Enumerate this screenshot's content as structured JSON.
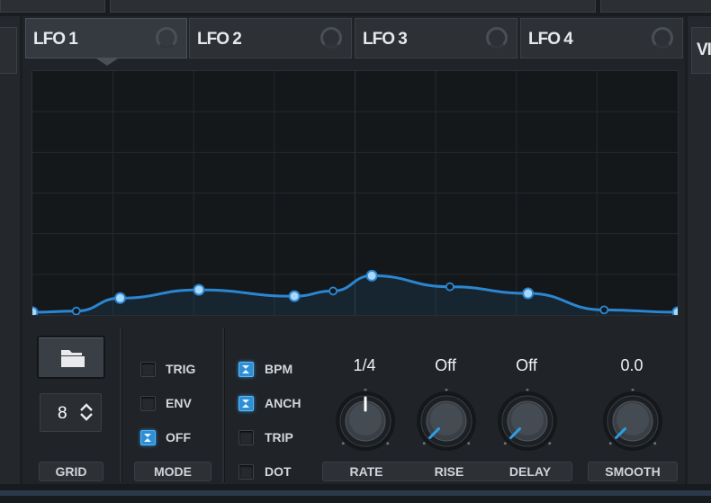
{
  "tabs": [
    {
      "label": "LFO 1",
      "active": true
    },
    {
      "label": "LFO 2",
      "active": false
    },
    {
      "label": "LFO 3",
      "active": false
    },
    {
      "label": "LFO 4",
      "active": false
    }
  ],
  "next_tab_partial": "VI",
  "graph": {
    "curve_color": "#2b86d1",
    "grid_divisions": 8,
    "points": [
      {
        "x": 0.0,
        "y": 0.0,
        "type": "anchor"
      },
      {
        "x": 0.068,
        "y": 0.005,
        "type": "curve"
      },
      {
        "x": 0.136,
        "y": 0.06,
        "type": "anchor"
      },
      {
        "x": 0.258,
        "y": 0.095,
        "type": "anchor"
      },
      {
        "x": 0.406,
        "y": 0.068,
        "type": "anchor"
      },
      {
        "x": 0.466,
        "y": 0.09,
        "type": "curve"
      },
      {
        "x": 0.526,
        "y": 0.155,
        "type": "anchor"
      },
      {
        "x": 0.647,
        "y": 0.108,
        "type": "curve"
      },
      {
        "x": 0.768,
        "y": 0.08,
        "type": "anchor"
      },
      {
        "x": 0.886,
        "y": 0.01,
        "type": "curve"
      },
      {
        "x": 1.0,
        "y": 0.0,
        "type": "anchor"
      }
    ]
  },
  "grid": {
    "value": "8",
    "label": "GRID"
  },
  "mode": {
    "label": "MODE",
    "options": [
      {
        "label": "TRIG",
        "checked": false
      },
      {
        "label": "ENV",
        "checked": false
      },
      {
        "label": "OFF",
        "checked": true
      }
    ]
  },
  "options": [
    {
      "label": "BPM",
      "checked": true
    },
    {
      "label": "ANCH",
      "checked": true
    },
    {
      "label": "TRIP",
      "checked": false
    },
    {
      "label": "DOT",
      "checked": false
    }
  ],
  "knobs": [
    {
      "name": "RATE",
      "value": "1/4",
      "position": 0.5,
      "accent": "#ffffff"
    },
    {
      "name": "RISE",
      "value": "Off",
      "position": 0.0,
      "accent": "#2b9fe6"
    },
    {
      "name": "DELAY",
      "value": "Off",
      "position": 0.0,
      "accent": "#2b9fe6"
    },
    {
      "name": "SMOOTH",
      "value": "0.0",
      "position": 0.0,
      "accent": "#2b9fe6"
    }
  ]
}
